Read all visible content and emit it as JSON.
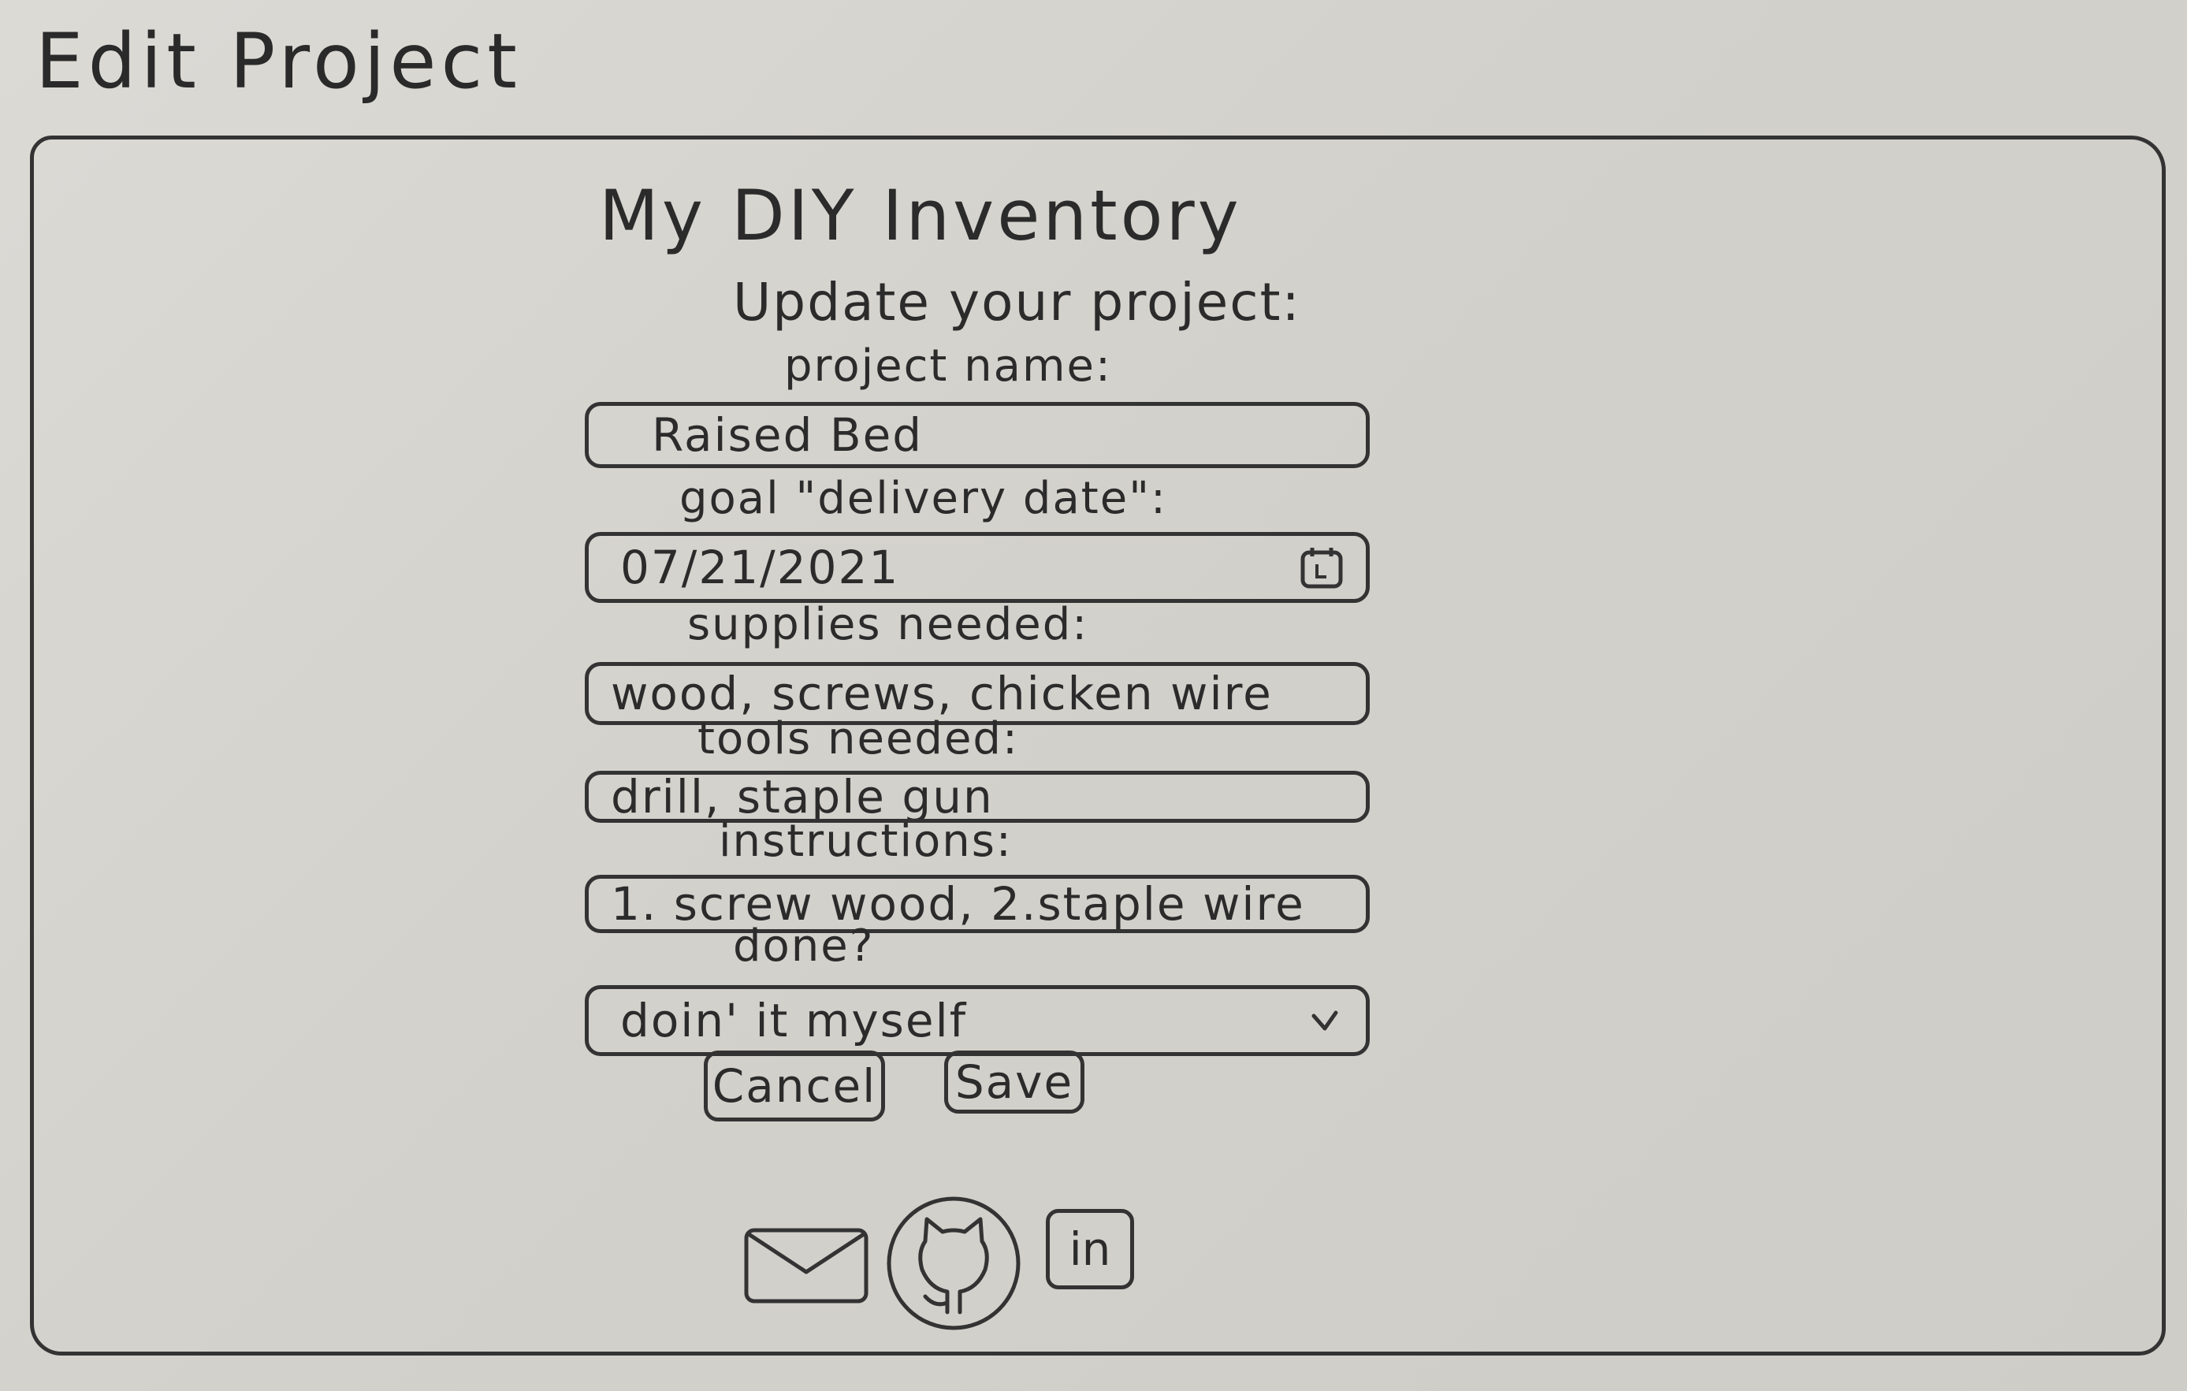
{
  "page_heading": "Edit Project",
  "app": {
    "title": "My DIY Inventory",
    "subtitle": "Update your project:"
  },
  "form": {
    "project_name": {
      "label": "project name:",
      "value": "Raised Bed"
    },
    "delivery_date": {
      "label": "goal \"delivery date\":",
      "value": "07/21/2021",
      "icon": "calendar-icon"
    },
    "supplies": {
      "label": "supplies needed:",
      "value": "wood, screws, chicken wire"
    },
    "tools": {
      "label": "tools needed:",
      "value": "drill, staple gun"
    },
    "instructions": {
      "label": "instructions:",
      "value": "1. screw wood, 2.staple wire"
    },
    "done": {
      "label": "done?",
      "selected": "doin' it myself",
      "icon": "chevron-down-icon"
    }
  },
  "buttons": {
    "cancel": "Cancel",
    "save": "Save"
  },
  "footer": {
    "icons": [
      "envelope-icon",
      "github-icon",
      "linkedin-icon"
    ],
    "linkedin_text": "in"
  }
}
